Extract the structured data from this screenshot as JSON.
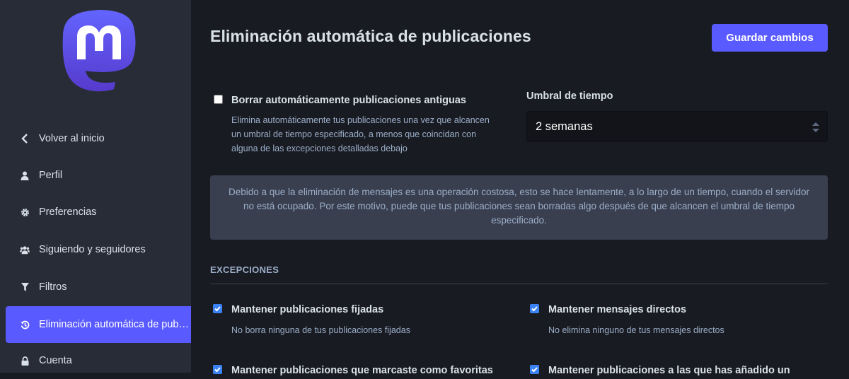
{
  "sidebar": {
    "logo_name": "mastodon-logo",
    "items": [
      {
        "label": "Volver al inicio",
        "icon": "chevron-left-icon"
      },
      {
        "label": "Perfil",
        "icon": "user-icon"
      },
      {
        "label": "Preferencias",
        "icon": "gear-icon"
      },
      {
        "label": "Siguiendo y seguidores",
        "icon": "users-icon"
      },
      {
        "label": "Filtros",
        "icon": "filter-icon"
      },
      {
        "label": "Eliminación automática de publicaciones",
        "icon": "history-icon",
        "active": true
      },
      {
        "label": "Cuenta",
        "icon": "lock-icon"
      }
    ]
  },
  "header": {
    "title": "Eliminación automática de publicaciones",
    "save_label": "Guardar cambios"
  },
  "auto_delete": {
    "label": "Borrar automáticamente publicaciones antiguas",
    "checked": false,
    "hint_lines": [
      "Elimina automáticamente tus publicaciones una vez que alcancen",
      "un umbral de tiempo especificado, a menos que coincidan con",
      "alguna de las excepciones detalladas debajo"
    ]
  },
  "threshold": {
    "label": "Umbral de tiempo",
    "value": "2 semanas"
  },
  "notice": {
    "text": "Debido a que la eliminación de mensajes es una operación costosa, esto se hace lentamente, a lo largo de un tiempo, cuando el servidor no está ocupado. Por este motivo, puede que tus publicaciones sean borradas algo después de que alcancen el umbral de tiempo especificado."
  },
  "exceptions": {
    "title": "EXCEPCIONES",
    "items": [
      {
        "label": "Mantener publicaciones fijadas",
        "hint": "No borra ninguna de tus publicaciones fijadas",
        "checked": true
      },
      {
        "label": "Mantener mensajes directos",
        "hint": "No elimina ninguno de tus mensajes directos",
        "checked": true
      },
      {
        "label": "Mantener publicaciones que marcaste como favoritas",
        "hint": "",
        "checked": true
      },
      {
        "label": "Mantener publicaciones a las que has añadido un",
        "hint": "",
        "checked": true
      }
    ]
  },
  "colors": {
    "accent": "#595aff",
    "sidebar_bg": "#282c37",
    "main_bg": "#191b22",
    "checkbox": "#3b82f6"
  }
}
